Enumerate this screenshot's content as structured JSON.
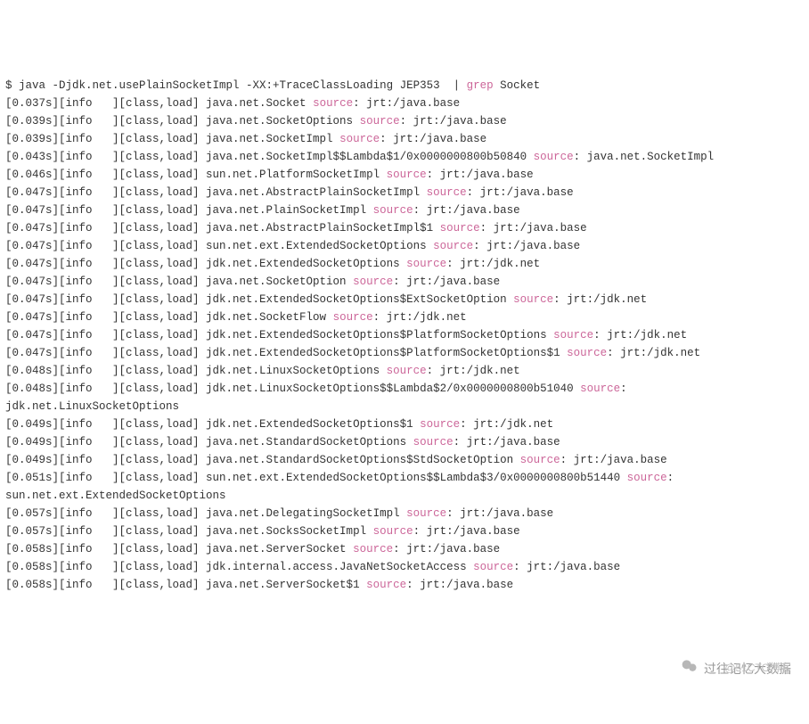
{
  "cmd": {
    "prompt": "$ ",
    "pre_grep": "java -Djdk.net.usePlainSocketImpl -XX:+TraceClassLoading JEP353  | ",
    "grep_kw": "grep",
    "post_grep": " Socket"
  },
  "kw_source": "source",
  "lines": [
    {
      "ts": "0.037s",
      "cls": "java.net.Socket",
      "src": "jrt:/java.base"
    },
    {
      "ts": "0.039s",
      "cls": "java.net.SocketOptions",
      "src": "jrt:/java.base"
    },
    {
      "ts": "0.039s",
      "cls": "java.net.SocketImpl",
      "src": "jrt:/java.base"
    },
    {
      "ts": "0.043s",
      "cls": "java.net.SocketImpl$$Lambda$1/0x0000000800b50840",
      "src": "java.net.SocketImpl"
    },
    {
      "ts": "0.046s",
      "cls": "sun.net.PlatformSocketImpl",
      "src": "jrt:/java.base"
    },
    {
      "ts": "0.047s",
      "cls": "java.net.AbstractPlainSocketImpl",
      "src": "jrt:/java.base"
    },
    {
      "ts": "0.047s",
      "cls": "java.net.PlainSocketImpl",
      "src": "jrt:/java.base"
    },
    {
      "ts": "0.047s",
      "cls": "java.net.AbstractPlainSocketImpl$1",
      "src": "jrt:/java.base"
    },
    {
      "ts": "0.047s",
      "cls": "sun.net.ext.ExtendedSocketOptions",
      "src": "jrt:/java.base"
    },
    {
      "ts": "0.047s",
      "cls": "jdk.net.ExtendedSocketOptions",
      "src": "jrt:/jdk.net"
    },
    {
      "ts": "0.047s",
      "cls": "java.net.SocketOption",
      "src": "jrt:/java.base"
    },
    {
      "ts": "0.047s",
      "cls": "jdk.net.ExtendedSocketOptions$ExtSocketOption",
      "src": "jrt:/jdk.net"
    },
    {
      "ts": "0.047s",
      "cls": "jdk.net.SocketFlow",
      "src": "jrt:/jdk.net"
    },
    {
      "ts": "0.047s",
      "cls": "jdk.net.ExtendedSocketOptions$PlatformSocketOptions",
      "src": "jrt:/jdk.net"
    },
    {
      "ts": "0.047s",
      "cls": "jdk.net.ExtendedSocketOptions$PlatformSocketOptions$1",
      "src": "jrt:/jdk.net"
    },
    {
      "ts": "0.048s",
      "cls": "jdk.net.LinuxSocketOptions",
      "src": "jrt:/jdk.net"
    },
    {
      "ts": "0.048s",
      "cls": "jdk.net.LinuxSocketOptions$$Lambda$2/0x0000000800b51040",
      "src": "jdk.net.LinuxSocketOptions",
      "wrap": true
    },
    {
      "ts": "0.049s",
      "cls": "jdk.net.ExtendedSocketOptions$1",
      "src": "jrt:/jdk.net"
    },
    {
      "ts": "0.049s",
      "cls": "java.net.StandardSocketOptions",
      "src": "jrt:/java.base"
    },
    {
      "ts": "0.049s",
      "cls": "java.net.StandardSocketOptions$StdSocketOption",
      "src": "jrt:/java.base"
    },
    {
      "ts": "0.051s",
      "cls": "sun.net.ext.ExtendedSocketOptions$$Lambda$3/0x0000000800b51440",
      "src": "sun.net.ext.ExtendedSocketOptions",
      "wrap": true
    },
    {
      "ts": "0.057s",
      "cls": "java.net.DelegatingSocketImpl",
      "src": "jrt:/java.base"
    },
    {
      "ts": "0.057s",
      "cls": "java.net.SocksSocketImpl",
      "src": "jrt:/java.base"
    },
    {
      "ts": "0.058s",
      "cls": "java.net.ServerSocket",
      "src": "jrt:/java.base"
    },
    {
      "ts": "0.058s",
      "cls": "jdk.internal.access.JavaNetSocketAccess",
      "src": "jrt:/java.base"
    },
    {
      "ts": "0.058s",
      "cls": "java.net.ServerSocket$1",
      "src": "jrt:/java.base"
    }
  ],
  "watermark": {
    "main": "过往记忆大数据",
    "sub": "@51CTO博客"
  }
}
